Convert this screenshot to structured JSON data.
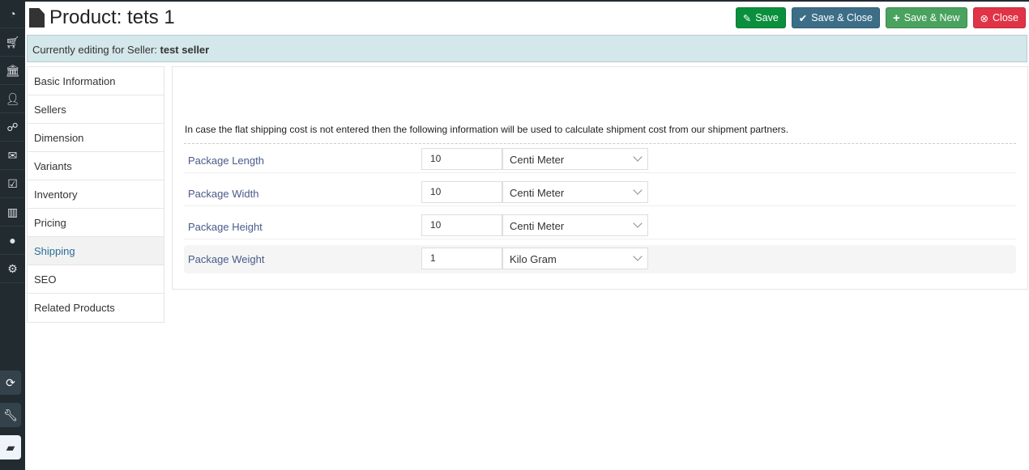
{
  "sidebar": {
    "icons": [
      "dashboard-icon",
      "cart-icon",
      "bank-icon",
      "user-icon",
      "sitemap-icon",
      "envelope-icon",
      "checkbox-icon",
      "bar-chart-icon",
      "globe-icon",
      "gear-icon"
    ],
    "bottom_icons": [
      "refresh-icon",
      "wrench-icon",
      "book-icon"
    ]
  },
  "header": {
    "title": "Product: tets 1",
    "buttons": [
      {
        "label": "Save",
        "icon": "edit-icon",
        "color": "#0a8f3c"
      },
      {
        "label": "Save & Close",
        "icon": "check-icon",
        "color": "#3d6e88"
      },
      {
        "label": "Save & New",
        "icon": "plus-icon",
        "color": "#4aa25f"
      },
      {
        "label": "Close",
        "icon": "close-circle-icon",
        "color": "#e03346"
      }
    ]
  },
  "info": {
    "prefix": "Currently editing for Seller: ",
    "seller": "test seller"
  },
  "tabs": [
    "Basic Information",
    "Sellers",
    "Dimension",
    "Variants",
    "Inventory",
    "Pricing",
    "Shipping",
    "SEO",
    "Related Products"
  ],
  "active_tab": "Shipping",
  "shipping": {
    "note": "In case the flat shipping cost is not entered then the following information will be used to calculate shipment cost from our shipment partners.",
    "rows": [
      {
        "label": "Package Length",
        "value": "10",
        "unit": "Centi Meter"
      },
      {
        "label": "Package Width",
        "value": "10",
        "unit": "Centi Meter"
      },
      {
        "label": "Package Height",
        "value": "10",
        "unit": "Centi Meter"
      },
      {
        "label": "Package Weight",
        "value": "1",
        "unit": "Kilo Gram"
      }
    ]
  }
}
